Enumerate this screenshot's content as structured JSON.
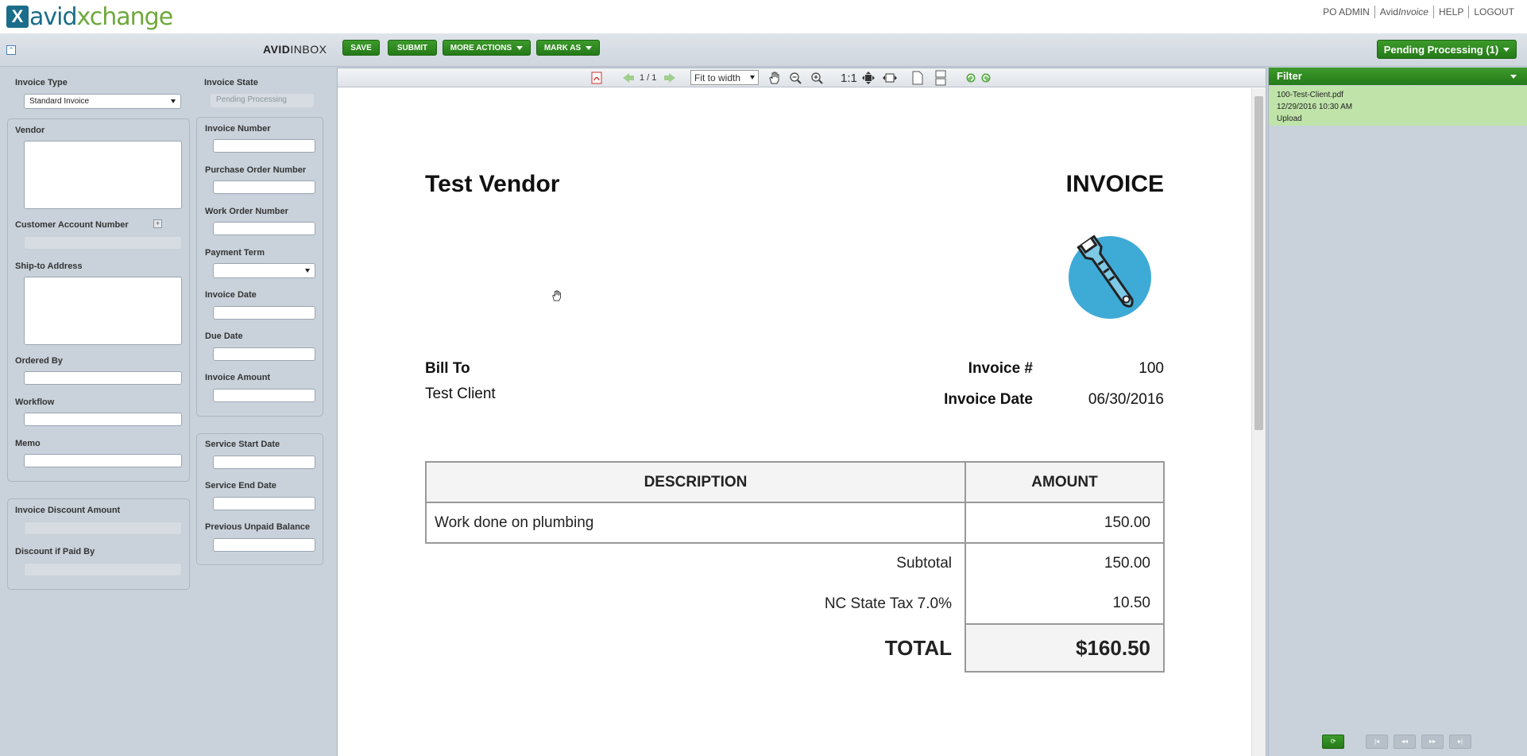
{
  "header": {
    "logo_x": "X",
    "logo_avid": "avid",
    "logo_xchange": "xchange",
    "links": [
      "PO ADMIN",
      "AvidInvoice",
      "HELP",
      "LOGOUT"
    ],
    "avidinvoice_prefix": "Avid",
    "avidinvoice_suffix": "Invoice"
  },
  "toolbar": {
    "inbox_bold": "AVID",
    "inbox_rest": "INBOX",
    "save": "SAVE",
    "submit": "SUBMIT",
    "more_actions": "MORE ACTIONS",
    "mark_as": "MARK AS",
    "pending": "Pending Processing (1)"
  },
  "form": {
    "invoice_type_label": "Invoice Type",
    "invoice_type_value": "Standard Invoice",
    "invoice_state_label": "Invoice State",
    "invoice_state_value": "Pending Processing",
    "vendor": "Vendor",
    "customer_account_number": "Customer Account Number",
    "ship_to": "Ship-to Address",
    "ordered_by": "Ordered By",
    "workflow": "Workflow",
    "memo": "Memo",
    "invoice_discount_amount": "Invoice Discount Amount",
    "discount_if_paid_by": "Discount if Paid By",
    "invoice_number": "Invoice Number",
    "po_number": "Purchase Order Number",
    "wo_number": "Work Order Number",
    "payment_term": "Payment Term",
    "invoice_date": "Invoice Date",
    "due_date": "Due Date",
    "invoice_amount": "Invoice Amount",
    "service_start": "Service Start Date",
    "service_end": "Service End Date",
    "prev_unpaid": "Previous Unpaid Balance"
  },
  "viewer": {
    "page_indicator": "1 / 1",
    "zoom": "Fit to width",
    "one_to_one": "1:1"
  },
  "document": {
    "vendor": "Test Vendor",
    "title": "INVOICE",
    "bill_to_label": "Bill To",
    "bill_to": "Test Client",
    "invoice_no_label": "Invoice #",
    "invoice_no": "100",
    "invoice_date_label": "Invoice Date",
    "invoice_date": "06/30/2016",
    "col_description": "DESCRIPTION",
    "col_amount": "AMOUNT",
    "line_desc": "Work done on plumbing",
    "line_amount": "150.00",
    "subtotal_label": "Subtotal",
    "subtotal": "150.00",
    "tax_label": "NC State Tax 7.0%",
    "tax": "10.50",
    "total_label": "TOTAL",
    "total": "$160.50"
  },
  "filter": {
    "title": "Filter",
    "file_name": "100-Test-Client.pdf",
    "file_date": "12/29/2016 10:30 AM",
    "file_source": "Upload"
  },
  "colors": {
    "brand_green": "#2f8a22",
    "brand_blue": "#1b6d8a",
    "selected_item": "#bfe3a9"
  }
}
